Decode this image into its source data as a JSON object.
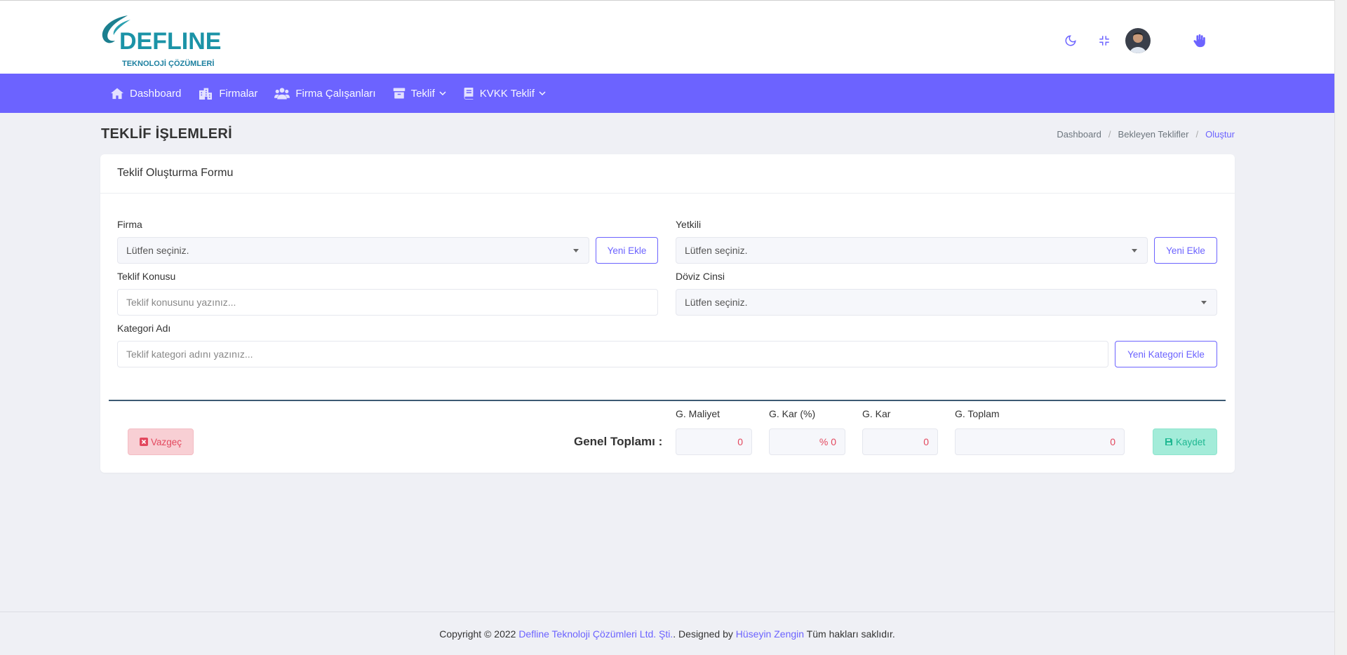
{
  "brand": {
    "logo_text": "DEFLINE",
    "logo_subtext": "TEKNOLOJİ ÇÖZÜMLERİ"
  },
  "topbar": {
    "icons": [
      "moon-icon",
      "compress-icon",
      "avatar",
      "hand-icon"
    ]
  },
  "nav": {
    "items": [
      {
        "label": "Dashboard",
        "icon": "home-icon"
      },
      {
        "label": "Firmalar",
        "icon": "building-icon"
      },
      {
        "label": "Firma Çalışanları",
        "icon": "users-icon"
      },
      {
        "label": "Teklif",
        "icon": "archive-icon",
        "dropdown": true
      },
      {
        "label": "KVKK Teklif",
        "icon": "book-icon",
        "dropdown": true
      }
    ],
    "color": "#6c63ff"
  },
  "page": {
    "title": "TEKLİF İŞLEMLERİ",
    "breadcrumb": [
      "Dashboard",
      "Bekleyen Teklifler",
      "Oluştur"
    ]
  },
  "form": {
    "card_title": "Teklif Oluşturma Formu",
    "firma": {
      "label": "Firma",
      "value": "Lütfen seçiniz.",
      "button": "Yeni Ekle"
    },
    "yetkili": {
      "label": "Yetkili",
      "value": "Lütfen seçiniz.",
      "button": "Yeni Ekle"
    },
    "konu": {
      "label": "Teklif Konusu",
      "placeholder": "Teklif konusunu yazınız..."
    },
    "doviz": {
      "label": "Döviz Cinsi",
      "value": "Lütfen seçiniz."
    },
    "kategori": {
      "label": "Kategori Adı",
      "placeholder": "Teklif kategori adını yazınız...",
      "button": "Yeni Kategori Ekle"
    }
  },
  "totals": {
    "genel_label": "Genel Toplamı :",
    "maliyet": {
      "label": "G. Maliyet",
      "value": "0"
    },
    "kar_pct": {
      "label": "G. Kar (%)",
      "value": "% 0"
    },
    "kar": {
      "label": "G. Kar",
      "value": "0"
    },
    "toplam": {
      "label": "G. Toplam",
      "value": "0"
    }
  },
  "actions": {
    "cancel": "Vazgeç",
    "save": "Kaydet"
  },
  "footer": {
    "prefix": "Copyright © 2022 ",
    "company": "Defline Teknoloji Çözümleri Ltd. Şti.",
    "middle": ". Designed by ",
    "designer": "Hüseyin Zengin",
    "suffix": " Tüm hakları saklıdır."
  }
}
